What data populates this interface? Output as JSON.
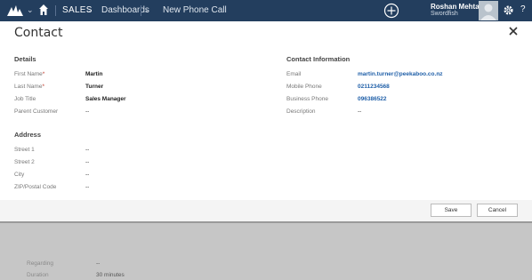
{
  "nav": {
    "module": "SALES",
    "area": "Dashboards",
    "page": "New Phone Call",
    "user_name": "Roshan Mehta",
    "user_org": "Swordfish",
    "help": "?"
  },
  "dialog": {
    "title": "Contact",
    "details": {
      "heading": "Details",
      "fields": [
        {
          "label": "First Name",
          "required": "*",
          "value": "Martin"
        },
        {
          "label": "Last Name",
          "required": "*",
          "value": "Turner"
        },
        {
          "label": "Job Title",
          "value": "Sales Manager"
        },
        {
          "label": "Parent Customer",
          "value": "--"
        }
      ]
    },
    "address": {
      "heading": "Address",
      "fields": [
        {
          "label": "Street 1",
          "value": "--"
        },
        {
          "label": "Street 2",
          "value": "--"
        },
        {
          "label": "City",
          "value": "--"
        },
        {
          "label": "ZIP/Postal Code",
          "value": "--"
        }
      ]
    },
    "contact_info": {
      "heading": "Contact Information",
      "fields": [
        {
          "label": "Email",
          "value": "martin.turner@peekaboo.co.nz"
        },
        {
          "label": "Mobile Phone",
          "value": "0211234568"
        },
        {
          "label": "Business Phone",
          "value": "096386522"
        },
        {
          "label": "Description",
          "value": "--"
        }
      ]
    },
    "save_label": "Save",
    "cancel_label": "Cancel"
  },
  "background": {
    "regarding_label": "Regarding",
    "regarding_value": "--",
    "duration_label": "Duration",
    "duration_value": "30 minutes"
  },
  "colors": {
    "nav_bg": "#233e5e",
    "link": "#1f5fa8",
    "required": "#c0392b"
  }
}
